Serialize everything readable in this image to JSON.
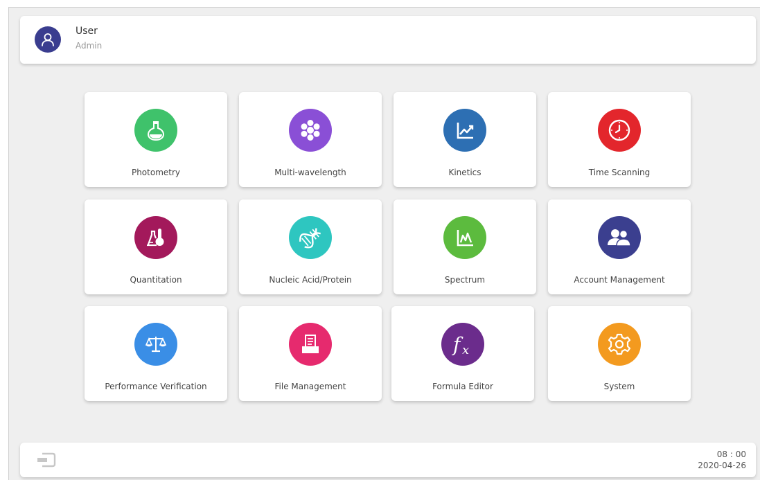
{
  "header": {
    "user_name": "User",
    "user_role": "Admin",
    "avatar_icon": "person-icon"
  },
  "tiles": [
    {
      "label": "Photometry",
      "icon": "flask-icon",
      "color": "#3fc26b"
    },
    {
      "label": "Multi-wavelength",
      "icon": "hexagon-cluster-icon",
      "color": "#8a4fd6"
    },
    {
      "label": "Kinetics",
      "icon": "line-chart-icon",
      "color": "#2d6fb3"
    },
    {
      "label": "Time Scanning",
      "icon": "clock-icon",
      "color": "#e3262c"
    },
    {
      "label": "Quantitation",
      "icon": "thermometer-flask-icon",
      "color": "#a3195b"
    },
    {
      "label": "Nucleic Acid/Protein",
      "icon": "dna-icon",
      "color": "#2ec6c0"
    },
    {
      "label": "Spectrum",
      "icon": "spectrum-chart-icon",
      "color": "#5cbb3e"
    },
    {
      "label": "Account Management",
      "icon": "users-icon",
      "color": "#3b3f8f"
    },
    {
      "label": "Performance Verification",
      "icon": "balance-scale-icon",
      "color": "#3a8ee6"
    },
    {
      "label": "File Management",
      "icon": "file-tray-icon",
      "color": "#e62a6e"
    },
    {
      "label": "Formula Editor",
      "icon": "function-icon",
      "color": "#6b2c8c"
    },
    {
      "label": "System",
      "icon": "gear-icon",
      "color": "#f39a1f"
    }
  ],
  "footer": {
    "exit_icon": "exit-icon",
    "time": "08 : 00",
    "date": "2020-04-26"
  }
}
